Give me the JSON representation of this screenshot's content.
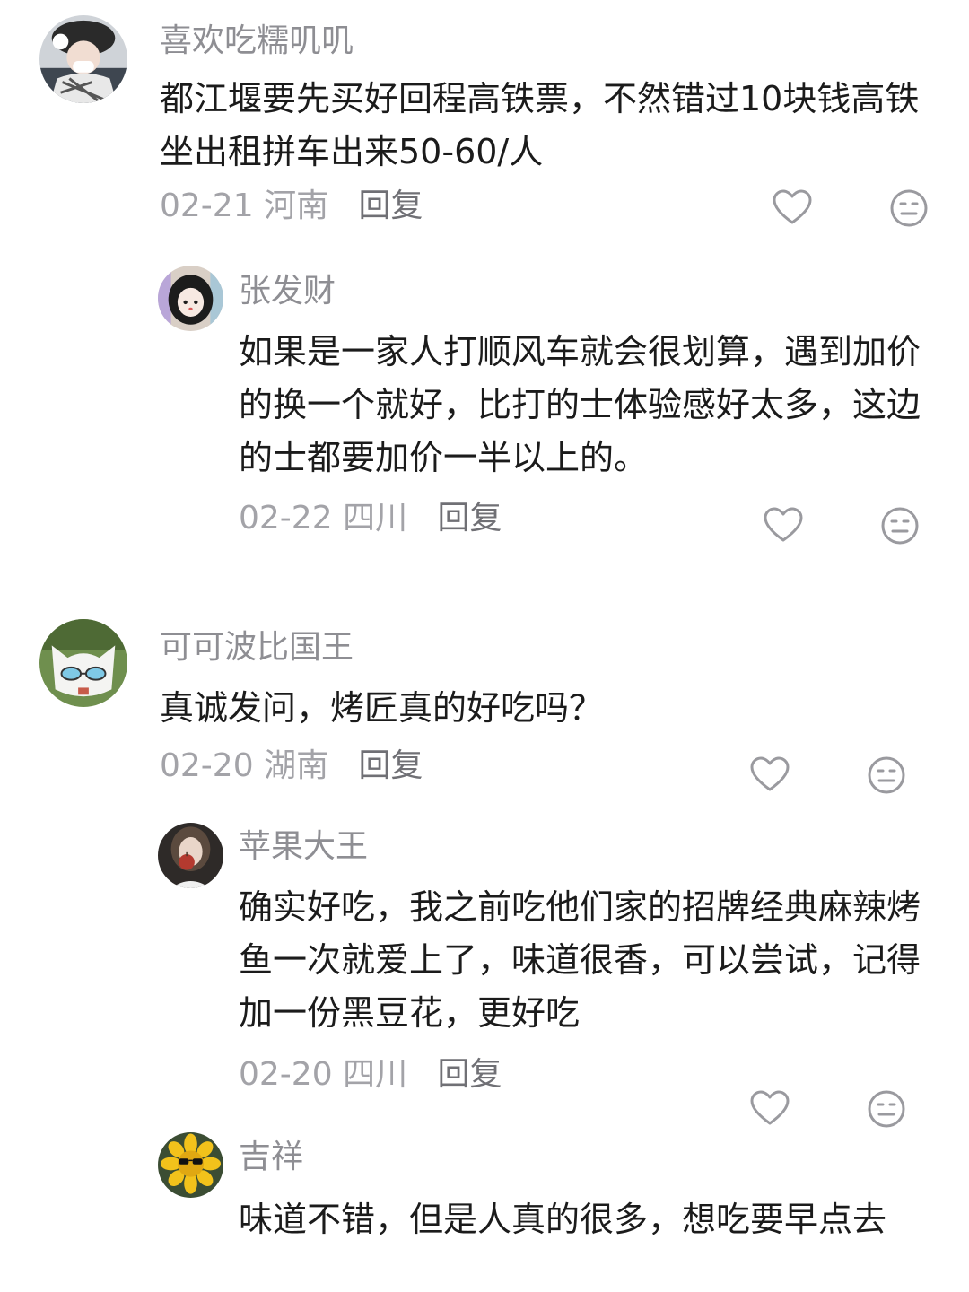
{
  "comments": [
    {
      "username": "喜欢吃糯叽叽",
      "content_lines": [
        "都江堰要先买好回程高铁票，不然错过10块钱高铁",
        "坐出租拼车出来50-60/人"
      ],
      "date": "02-21",
      "location": "河南",
      "reply_label": "回复",
      "avatar_icon": "girl-with-hat-avatar",
      "replies": [
        {
          "username": "张发财",
          "content_lines": [
            "如果是一家人打顺风车就会很划算，遇到加价",
            "的换一个就好，比打的士体验感好太多，这边",
            "的士都要加价一半以上的。"
          ],
          "date": "02-22",
          "location": "四川",
          "reply_label": "回复",
          "avatar_icon": "cartoon-girl-avatar"
        }
      ]
    },
    {
      "username": "可可波比国王",
      "content_lines": [
        "真诚发问，烤匠真的好吃吗？"
      ],
      "date": "02-20",
      "location": "湖南",
      "reply_label": "回复",
      "avatar_icon": "white-cat-sunglasses-avatar",
      "replies": [
        {
          "username": "苹果大王",
          "content_lines": [
            "确实好吃，我之前吃他们家的招牌经典麻辣烤",
            "鱼一次就爱上了，味道很香，可以尝试，记得",
            "加一份黑豆花，更好吃"
          ],
          "date": "02-20",
          "location": "四川",
          "reply_label": "回复",
          "avatar_icon": "person-holding-apple-avatar"
        },
        {
          "username": "吉祥",
          "content_lines": [
            "味道不错，但是人真的很多，想吃要早点去"
          ],
          "avatar_icon": "sunflower-sunglasses-avatar"
        }
      ]
    }
  ],
  "icons": {
    "like": "heart-outline-icon",
    "dislike": "neutral-face-icon"
  },
  "colors": {
    "username": "#8e8e93",
    "content": "#1b1b1b",
    "meta": "#a3a3a8",
    "icon": "#9a9a9f"
  }
}
